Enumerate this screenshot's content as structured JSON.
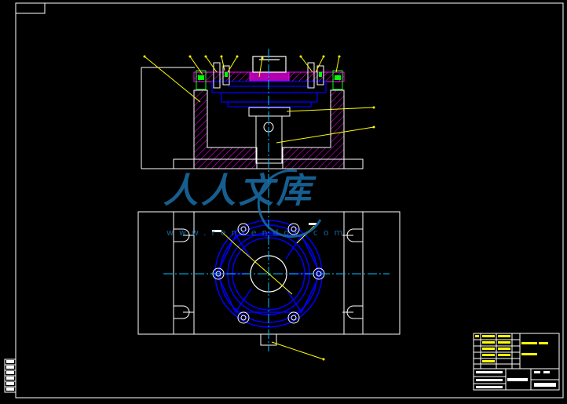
{
  "drawing": {
    "background_color": "#000000",
    "line_color": "#ffffff",
    "part_color": "#0000ff",
    "section_color": "#ff00ff",
    "leader_color": "#ffff00",
    "center_line_color": "#00bfff",
    "bolt_color": "#00ff00"
  },
  "watermark": {
    "text": "人人文库",
    "url": "www.renrendoc.com",
    "color": "#1a6fa8"
  },
  "title_block": {
    "present": true
  }
}
